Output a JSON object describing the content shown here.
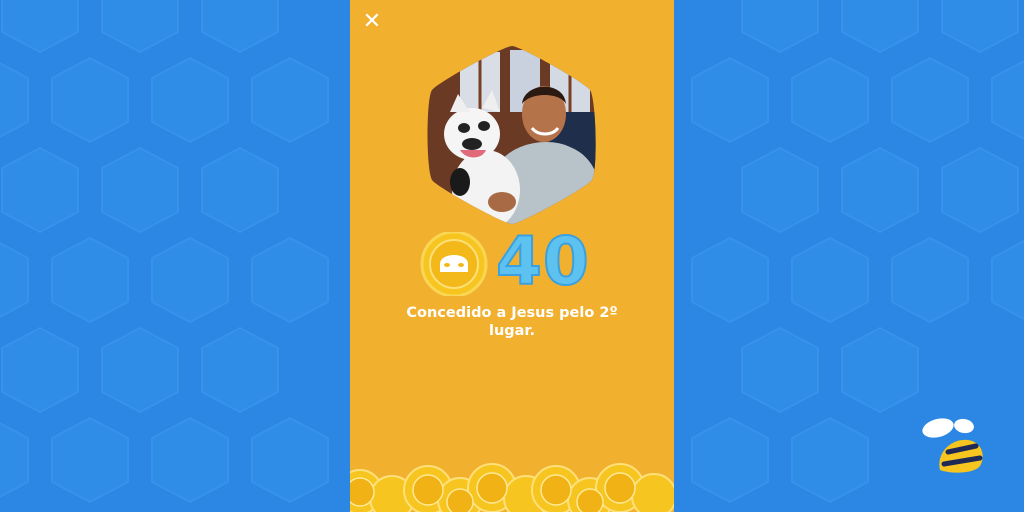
{
  "dialog": {
    "close_icon": "close-icon",
    "photo": "user-photo-dog",
    "coin_icon": "swarm-coin-icon",
    "points": "40",
    "caption": "Concedido a Jesus pelo 2º lugar."
  },
  "brand": {
    "logo": "swarm-bee-logo"
  },
  "colors": {
    "background": "#2b87e3",
    "panel": "#f2b02f",
    "points": "#5ec2f0",
    "coin": "#f6c21a"
  }
}
